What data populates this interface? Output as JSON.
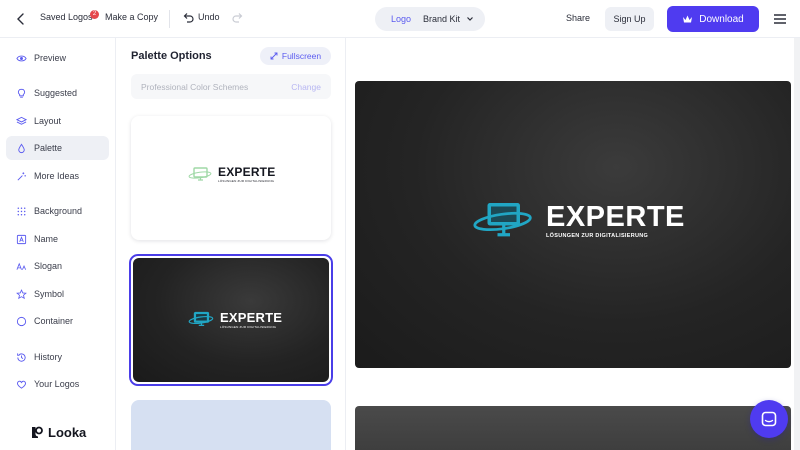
{
  "topbar": {
    "saved_logos": "Saved Logos",
    "saved_logos_badge": "2",
    "make_copy": "Make a Copy",
    "undo": "Undo",
    "seg_logo": "Logo",
    "seg_brand_kit": "Brand Kit",
    "share": "Share",
    "sign_up": "Sign Up",
    "download": "Download"
  },
  "sidebar": {
    "items": [
      {
        "label": "Preview",
        "icon": "eye-icon"
      },
      {
        "label": "Suggested",
        "icon": "lightbulb-icon"
      },
      {
        "label": "Layout",
        "icon": "layers-icon"
      },
      {
        "label": "Palette",
        "icon": "droplet-icon"
      },
      {
        "label": "More Ideas",
        "icon": "magic-wand-icon"
      },
      {
        "label": "Background",
        "icon": "grid-icon"
      },
      {
        "label": "Name",
        "icon": "name-icon"
      },
      {
        "label": "Slogan",
        "icon": "text-size-icon"
      },
      {
        "label": "Symbol",
        "icon": "star-icon"
      },
      {
        "label": "Container",
        "icon": "circle-icon"
      },
      {
        "label": "History",
        "icon": "history-icon"
      },
      {
        "label": "Your Logos",
        "icon": "heart-icon"
      }
    ],
    "active": "Palette",
    "brand": "Looka"
  },
  "panel": {
    "title": "Palette Options",
    "fullscreen": "Fullscreen",
    "scheme_label": "Professional Color Schemes",
    "scheme_change": "Change"
  },
  "logo": {
    "name": "EXPERTE",
    "slogan": "LÖSUNGEN ZUR DIGITALISIERUNG"
  },
  "colors": {
    "accent": "#4f3bf0",
    "logo_teal": "#21a6c4",
    "logo_green": "#9fd8a6",
    "dark_bg": "#232323",
    "swatch_blue": "#d6e0f2"
  }
}
